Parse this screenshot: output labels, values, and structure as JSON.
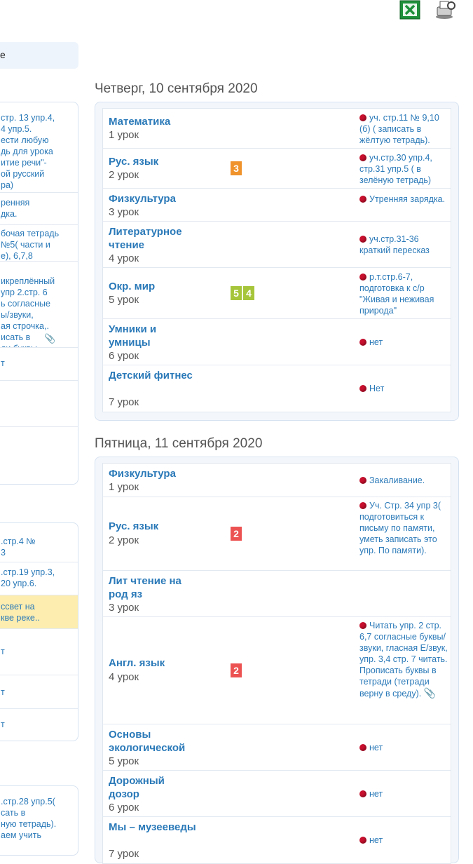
{
  "toolbar": {
    "excel_icon": "excel-icon",
    "print_icon": "print-icon"
  },
  "sidebar": {
    "search_fragment": "е"
  },
  "left_panels": [
    {
      "rows": [
        {
          "text": "стр. 13 упр.4,\n4 упр.5.\nести любую\nдь для урока\nитие речи\"-\nой русский\nра)",
          "highlight": false
        },
        {
          "text": "ренняя\nдка.",
          "highlight": false
        },
        {
          "text": "бочая тетрадь\n№5( части и\nе), 6,7,8",
          "highlight": false
        },
        {
          "text": "икреплённый\nупр 2.стр. 6\nь согласные\nы/звуки,\nая строчка,.\nисать в\nди буквы.",
          "highlight": false,
          "attachment": true
        },
        {
          "text": "т",
          "highlight": false
        },
        {
          "text": "",
          "highlight": false
        },
        {
          "text": "",
          "highlight": false
        }
      ]
    },
    {
      "rows": [
        {
          "text": ".стр.4 №\n3",
          "highlight": false
        },
        {
          "text": ".стр.19 упр.3,\n20 упр.6.",
          "highlight": false
        },
        {
          "text": "ссвет на\nкве реке..",
          "highlight": true
        },
        {
          "text": "т",
          "highlight": false
        },
        {
          "text": "т",
          "highlight": false
        },
        {
          "text": "т",
          "highlight": false
        }
      ]
    },
    {
      "rows": [
        {
          "text": ".стр.28 упр.5(\nсать в\nную тетрадь).\nаем учить",
          "highlight": false
        }
      ]
    }
  ],
  "days": [
    {
      "title": "Четверг, 10 сентября 2020",
      "lessons": [
        {
          "subject": "Математика",
          "number": "1 урок",
          "grades": [],
          "homework": "уч. стр.11 № 9,10 (б) ( записать в жёлтую тетрадь).",
          "attachment": false
        },
        {
          "subject": "Рус. язык",
          "number": "2 урок",
          "grades": [
            {
              "value": "3",
              "color": "#f0932b"
            }
          ],
          "homework": "уч.стр.30 упр.4, стр.31 упр.5 ( в зелёную тетрадь)",
          "attachment": false
        },
        {
          "subject": "Физкультура",
          "number": "3 урок",
          "grades": [],
          "homework": "Утренняя зарядка.",
          "attachment": false
        },
        {
          "subject": "Литературное чтение",
          "number": "4 урок",
          "grades": [],
          "homework": "уч.стр.31-36 краткий пересказ",
          "attachment": false
        },
        {
          "subject": "Окр. мир",
          "number": "5 урок",
          "grades": [
            {
              "value": "5",
              "color": "#a6c53a"
            },
            {
              "value": "4",
              "color": "#a6c53a"
            }
          ],
          "homework": "р.т.стр.6-7, подготовка к с/р \"Живая и неживая природа\"",
          "attachment": false
        },
        {
          "subject": "Умники и умницы",
          "number": "6 урок",
          "grades": [],
          "homework": "нет",
          "attachment": false
        },
        {
          "subject": "Детский фитнес",
          "number": "7 урок",
          "grades": [],
          "homework": "Нет",
          "attachment": false
        }
      ]
    },
    {
      "title": "Пятница, 11 сентября 2020",
      "lessons": [
        {
          "subject": "Физкультура",
          "number": "1 урок",
          "grades": [],
          "homework": "Закаливание.",
          "attachment": false
        },
        {
          "subject": "Рус. язык",
          "number": "2 урок",
          "grades": [
            {
              "value": "2",
              "color": "#ec5252"
            }
          ],
          "homework": "Уч. Стр. 34 упр 3( подготовиться к письму по памяти, уметь записать это упр. По памяти).",
          "attachment": false
        },
        {
          "subject": "Лит чтение на род яз",
          "number": "3 урок",
          "grades": [],
          "homework": "",
          "attachment": false
        },
        {
          "subject": "Англ. язык",
          "number": "4 урок",
          "grades": [
            {
              "value": "2",
              "color": "#ec5252"
            }
          ],
          "homework": "Читать упр. 2 стр. 6,7 согласные буквы/звуки, гласная Е/звук, упр. 3,4 стр. 7 читать. Прописать буквы в тетради (тетради верну в среду).",
          "attachment": true
        },
        {
          "subject": "Основы экологической",
          "number": "5 урок",
          "grades": [],
          "homework": "нет",
          "attachment": false
        },
        {
          "subject": "Дорожный дозор",
          "number": "6 урок",
          "grades": [],
          "homework": "нет",
          "attachment": false
        },
        {
          "subject": "Мы – музееведы",
          "number": "7 урок",
          "grades": [],
          "homework": "нет",
          "attachment": false
        }
      ]
    }
  ]
}
